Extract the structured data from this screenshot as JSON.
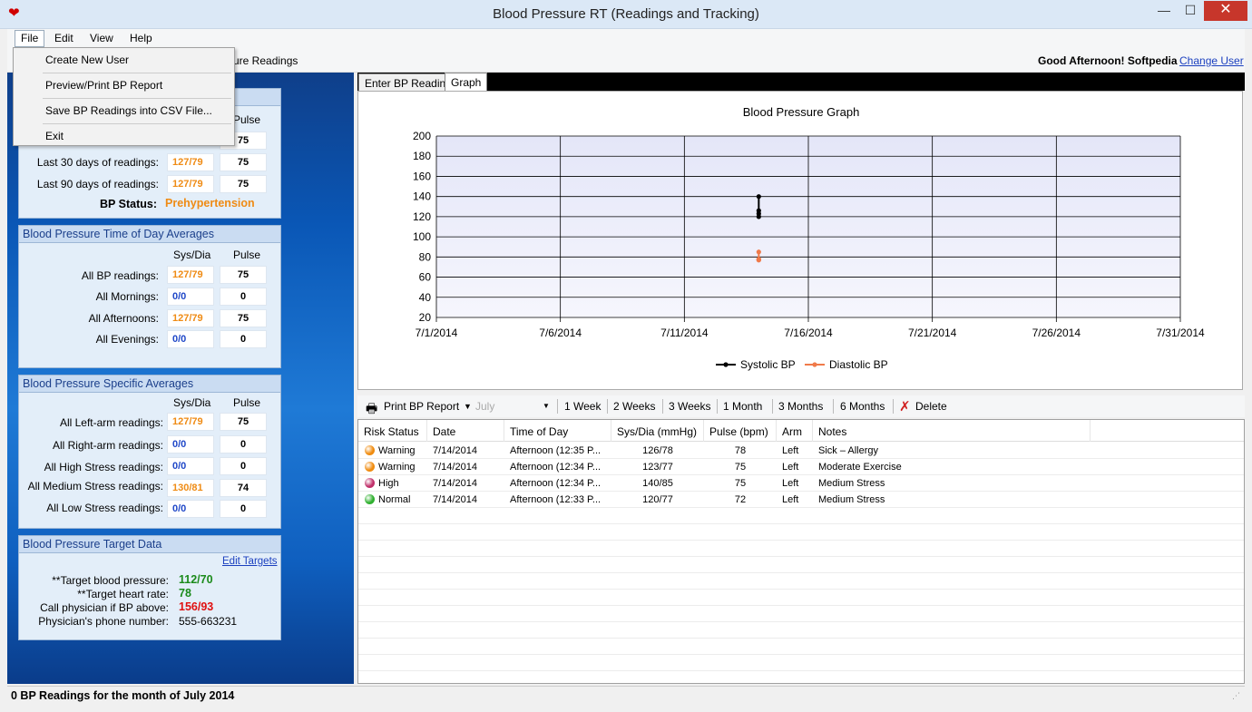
{
  "window": {
    "title": "Blood Pressure RT (Readings and Tracking)"
  },
  "menubar": {
    "items": [
      "File",
      "Edit",
      "View",
      "Help"
    ]
  },
  "file_menu": {
    "items": [
      "Create New User",
      "Preview/Print BP Report",
      "Save BP Readings into CSV File...",
      "Exit"
    ]
  },
  "toolbar": {
    "partial_label": "ure Readings",
    "greeting": "Good Afternoon! Softpedia",
    "change_user": "Change User"
  },
  "recent_box": {
    "pulse_header": "Pulse",
    "rows": [
      {
        "label": "",
        "sysdia": "",
        "pulse": "75"
      },
      {
        "label": "Last 30 days of readings:",
        "sysdia": "127/79",
        "pulse": "75"
      },
      {
        "label": "Last 90 days of readings:",
        "sysdia": "127/79",
        "pulse": "75"
      }
    ],
    "status_label": "BP Status:",
    "status_value": "Prehypertension"
  },
  "tod_box": {
    "title": "Blood Pressure Time of Day Averages",
    "col_sysdia": "Sys/Dia",
    "col_pulse": "Pulse",
    "rows": [
      {
        "label": "All BP readings:",
        "sysdia": "127/79",
        "pulse": "75"
      },
      {
        "label": "All Mornings:",
        "sysdia": "0/0",
        "pulse": "0"
      },
      {
        "label": "All Afternoons:",
        "sysdia": "127/79",
        "pulse": "75"
      },
      {
        "label": "All Evenings:",
        "sysdia": "0/0",
        "pulse": "0"
      }
    ]
  },
  "specific_box": {
    "title": "Blood Pressure Specific Averages",
    "col_sysdia": "Sys/Dia",
    "col_pulse": "Pulse",
    "rows": [
      {
        "label": "All Left-arm readings:",
        "sysdia": "127/79",
        "pulse": "75"
      },
      {
        "label": "All Right-arm readings:",
        "sysdia": "0/0",
        "pulse": "0"
      },
      {
        "label": "All High Stress readings:",
        "sysdia": "0/0",
        "pulse": "0"
      },
      {
        "label": "All Medium Stress readings:",
        "sysdia": "130/81",
        "pulse": "74"
      },
      {
        "label": "All Low Stress readings:",
        "sysdia": "0/0",
        "pulse": "0"
      }
    ]
  },
  "target_box": {
    "title": "Blood Pressure Target Data",
    "edit_link": "Edit Targets",
    "rows": [
      {
        "label": "**Target blood pressure:",
        "value": "112/70",
        "color": "#1a8a1a"
      },
      {
        "label": "**Target heart rate:",
        "value": "78",
        "color": "#1a8a1a"
      },
      {
        "label": "Call physician if BP above:",
        "value": "156/93",
        "color": "#e01010"
      },
      {
        "label": "Physician's phone number:",
        "value": "555-663231",
        "color": "#000000"
      }
    ]
  },
  "tabs": {
    "enter": "Enter BP Reading",
    "graph": "Graph"
  },
  "chart_data": {
    "type": "line",
    "title": "Blood Pressure Graph",
    "y_ticks": [
      "200",
      "180",
      "160",
      "140",
      "120",
      "100",
      "80",
      "60",
      "40",
      "20"
    ],
    "ylim": [
      20,
      200
    ],
    "x_ticks": [
      "7/1/2014",
      "7/6/2014",
      "7/11/2014",
      "7/16/2014",
      "7/21/2014",
      "7/26/2014",
      "7/31/2014"
    ],
    "xlim_days": [
      1,
      31
    ],
    "series": [
      {
        "name": "Systolic BP",
        "color": "#000000",
        "x": [
          14,
          14,
          14,
          14
        ],
        "values": [
          140,
          126,
          123,
          120
        ]
      },
      {
        "name": "Diastolic BP",
        "color": "#f07a4a",
        "x": [
          14,
          14,
          14,
          14
        ],
        "values": [
          85,
          78,
          77,
          77
        ]
      }
    ],
    "grid": true,
    "legend": "bottom"
  },
  "report_toolbar": {
    "print": "Print BP Report",
    "month": "July",
    "ranges": [
      "1 Week",
      "2 Weeks",
      "3 Weeks",
      "1 Month",
      "3 Months",
      "6 Months"
    ],
    "delete": "Delete"
  },
  "table": {
    "columns": [
      "Risk Status",
      "Date",
      "Time of Day",
      "Sys/Dia (mmHg)",
      "Pulse (bpm)",
      "Arm",
      "Notes"
    ],
    "rows": [
      {
        "status": "Warning",
        "color": "#f08c10",
        "date": "7/14/2014",
        "time": "Afternoon (12:35 P...",
        "sysdia": "126/78",
        "pulse": "78",
        "arm": "Left",
        "notes": "Sick – Allergy"
      },
      {
        "status": "Warning",
        "color": "#f08c10",
        "date": "7/14/2014",
        "time": "Afternoon (12:34 P...",
        "sysdia": "123/77",
        "pulse": "75",
        "arm": "Left",
        "notes": "Moderate Exercise"
      },
      {
        "status": "High",
        "color": "#c0306a",
        "date": "7/14/2014",
        "time": "Afternoon (12:34 P...",
        "sysdia": "140/85",
        "pulse": "75",
        "arm": "Left",
        "notes": "Medium Stress"
      },
      {
        "status": "Normal",
        "color": "#30b030",
        "date": "7/14/2014",
        "time": "Afternoon (12:33 P...",
        "sysdia": "120/77",
        "pulse": "72",
        "arm": "Left",
        "notes": "Medium Stress"
      }
    ]
  },
  "statusbar": {
    "text": "0 BP Readings for the month of July 2014"
  }
}
